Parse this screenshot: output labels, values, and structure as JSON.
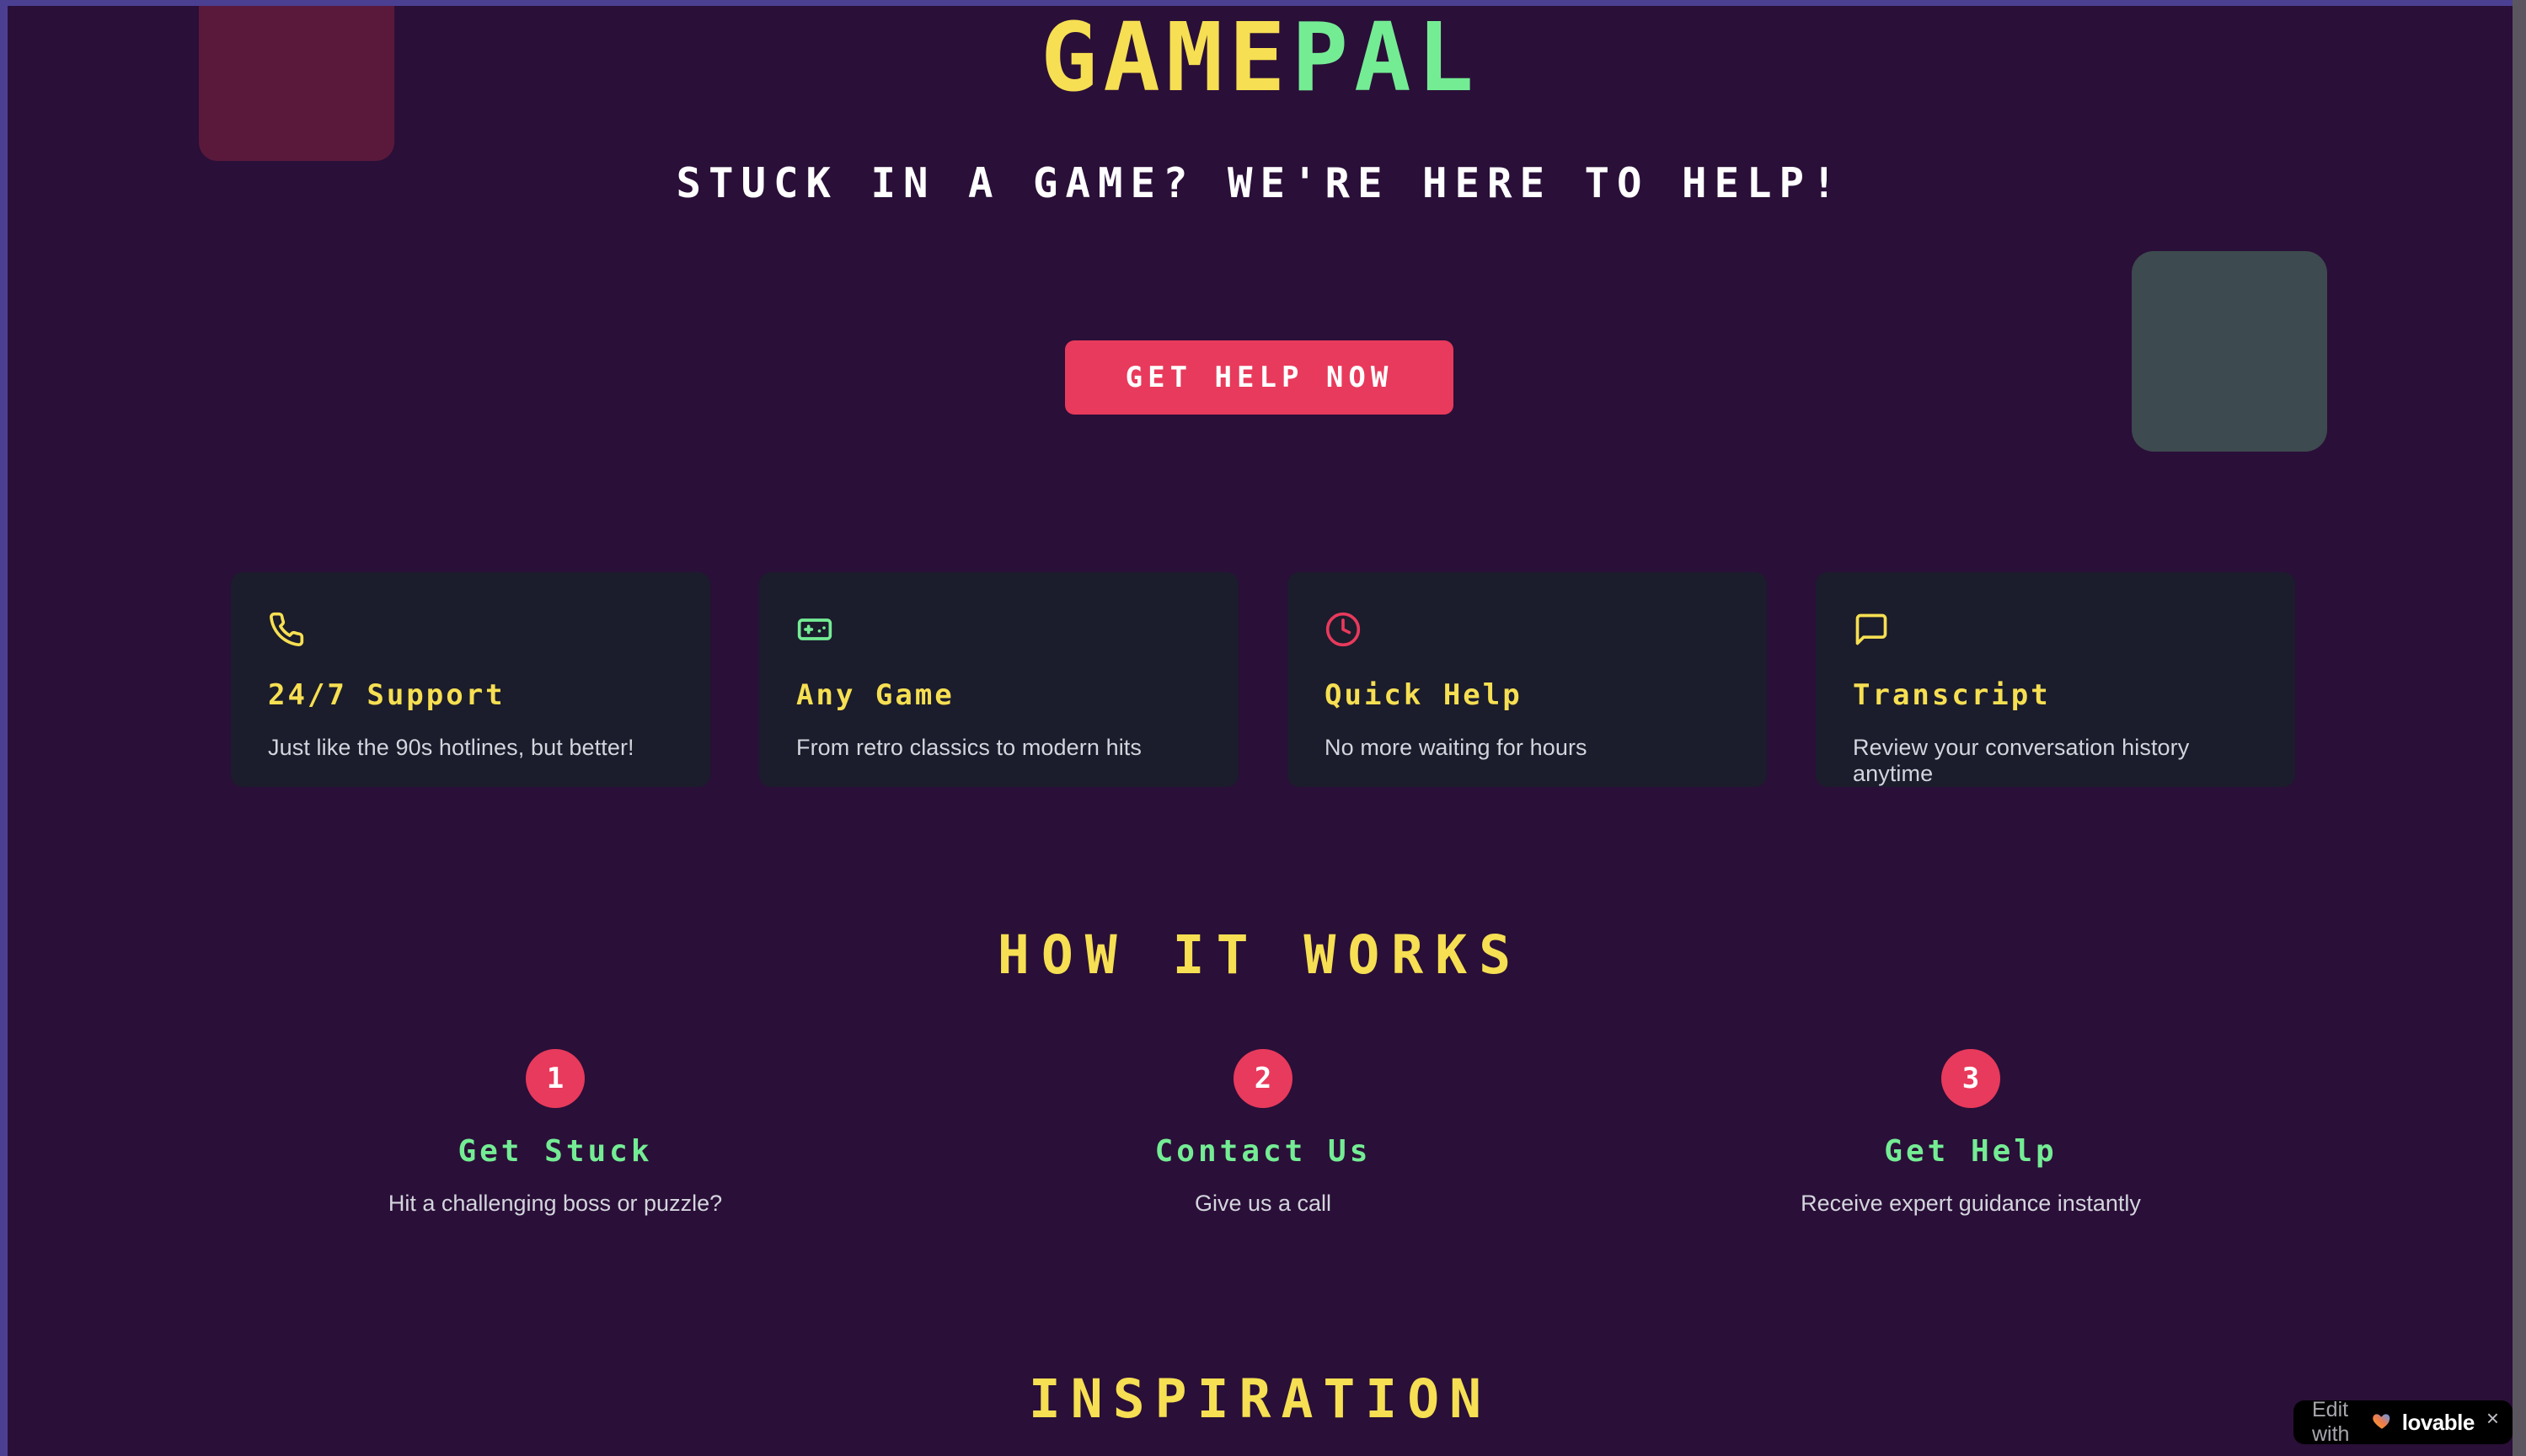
{
  "brand": {
    "part_one": "GAME",
    "part_two": "PAL",
    "color_one": "#f6df52",
    "color_two": "#74ec94"
  },
  "hero": {
    "tagline": "STUCK IN A GAME? WE'RE HERE TO HELP!",
    "cta_label": "GET HELP NOW",
    "cta_color": "#e83a5c"
  },
  "features": [
    {
      "icon": "phone-icon",
      "icon_color": "#f6df52",
      "title": "24/7 Support",
      "desc": "Just like the 90s hotlines, but better!"
    },
    {
      "icon": "gamepad-icon",
      "icon_color": "#74ec94",
      "title": "Any Game",
      "desc": "From retro classics to modern hits"
    },
    {
      "icon": "clock-icon",
      "icon_color": "#e83a5c",
      "title": "Quick Help",
      "desc": "No more waiting for hours"
    },
    {
      "icon": "message-square-icon",
      "icon_color": "#f6df52",
      "title": "Transcript",
      "desc": "Review your conversation history anytime"
    }
  ],
  "how_it_works": {
    "heading": "HOW IT WORKS",
    "steps": [
      {
        "number": "1",
        "title": "Get Stuck",
        "desc": "Hit a challenging boss or puzzle?"
      },
      {
        "number": "2",
        "title": "Contact Us",
        "desc": "Give us a call"
      },
      {
        "number": "3",
        "title": "Get Help",
        "desc": "Receive expert guidance instantly"
      }
    ]
  },
  "inspiration": {
    "heading": "INSPIRATION"
  },
  "lovable_badge": {
    "edit_label": "Edit with",
    "wordmark": "lovable",
    "close_label": "×"
  },
  "theme": {
    "page_background": "#2a0f38",
    "card_background": "#1b1c2c",
    "accent_yellow": "#f6df52",
    "accent_green": "#74ec94",
    "accent_pink": "#e83a5c"
  }
}
